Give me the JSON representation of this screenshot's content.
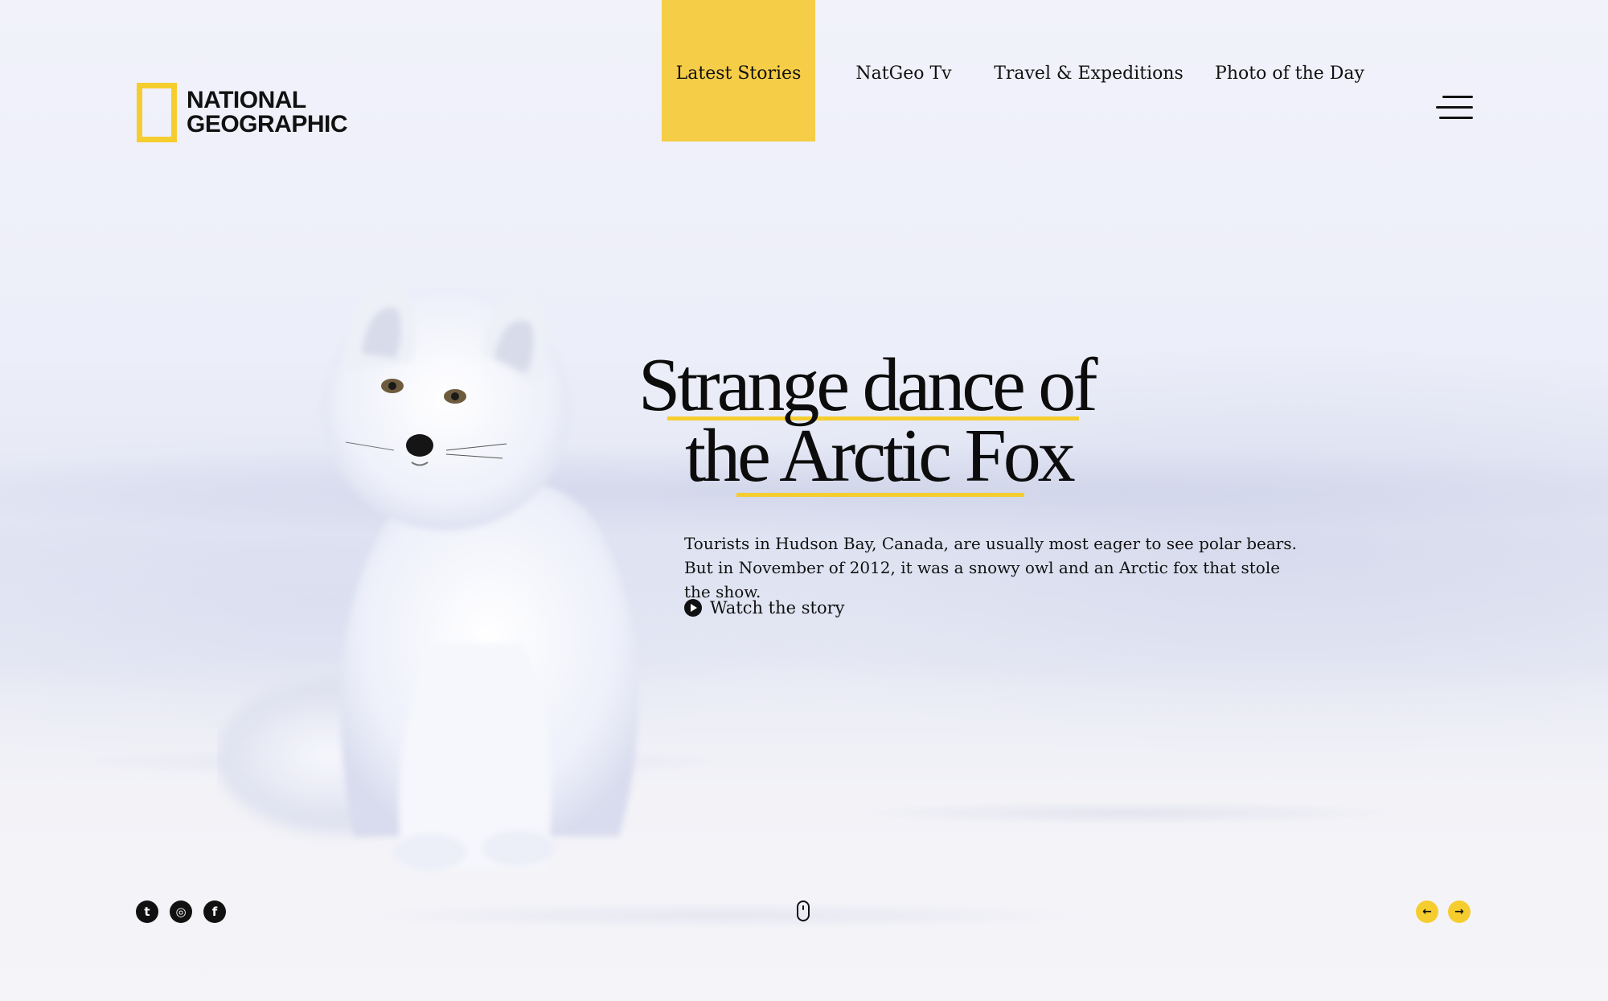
{
  "brand": {
    "logo_line1": "NATIONAL",
    "logo_line2": "GEOGRAPHIC",
    "accent_color": "#f6cd2e"
  },
  "nav": {
    "items": [
      {
        "label": "Latest Stories",
        "active": true
      },
      {
        "label": "NatGeo Tv",
        "active": false
      },
      {
        "label": "Travel & Expeditions",
        "active": false
      },
      {
        "label": "Photo of the Day",
        "active": false
      }
    ],
    "menu_icon": "hamburger-icon"
  },
  "hero": {
    "headline_line1": "Strange dance of",
    "headline_line2": "the Arctic Fox",
    "summary": "Tourists in Hudson Bay, Canada, are usually most eager to see polar bears. But in November of 2012, it was a snowy owl and an Arctic fox that stole the show.",
    "cta_label": "Watch  the story",
    "cta_icon": "play-icon"
  },
  "footer": {
    "social": [
      {
        "name": "twitter-icon",
        "glyph": "t"
      },
      {
        "name": "instagram-icon",
        "glyph": "◎"
      },
      {
        "name": "facebook-icon",
        "glyph": "f"
      }
    ],
    "scroll_icon": "mouse-scroll-icon",
    "prev_icon": "arrow-left-icon",
    "next_icon": "arrow-right-icon",
    "prev_glyph": "←",
    "next_glyph": "→"
  }
}
